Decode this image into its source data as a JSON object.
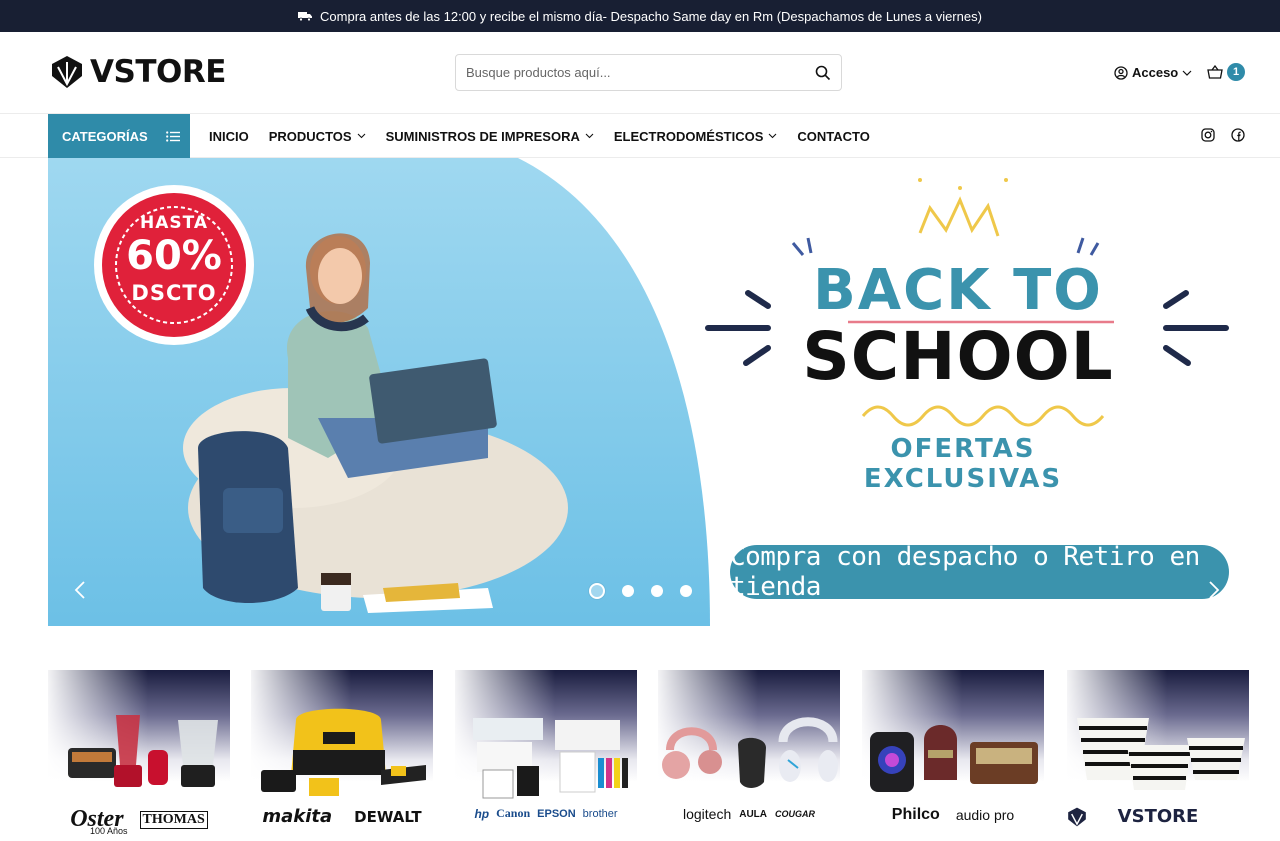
{
  "topbar": {
    "message": "Compra antes de las 12:00 y recibe el mismo día- Despacho Same day en Rm (Despachamos de Lunes a viernes)",
    "icon": "truck-icon"
  },
  "header": {
    "logo_text": "VSTORE",
    "search_placeholder": "Busque productos aquí...",
    "account_label": "Acceso",
    "cart_count": "1"
  },
  "nav": {
    "categories_label": "CATEGORÍAS",
    "items": [
      {
        "label": "INICIO",
        "dropdown": false
      },
      {
        "label": "PRODUCTOS",
        "dropdown": true
      },
      {
        "label": "SUMINISTROS DE IMPRESORA",
        "dropdown": true
      },
      {
        "label": "ELECTRODOMÉSTICOS",
        "dropdown": true
      },
      {
        "label": "CONTACTO",
        "dropdown": false
      }
    ],
    "social": [
      "instagram-icon",
      "facebook-icon"
    ]
  },
  "hero": {
    "seal_line1": "HASTA",
    "seal_line2": "60%",
    "seal_line3": "DSCTO",
    "title_line1": "BACK TO",
    "title_line2": "SCHOOL",
    "subtitle": "OFERTAS EXCLUSIVAS",
    "cta": "Compra con despacho o Retiro en tienda",
    "slide_count": 4,
    "active_slide": 1,
    "colors": {
      "accent": "#3b93ad",
      "seal_red": "#e0213a",
      "sky": "#8fd0ec"
    }
  },
  "brand_cards": [
    {
      "brands": [
        "Oster",
        "THOMAS"
      ],
      "extra": "100 Años"
    },
    {
      "brands": [
        "makita",
        "DEWALT"
      ]
    },
    {
      "brands": [
        "hp",
        "Canon",
        "EPSON",
        "brother"
      ]
    },
    {
      "brands": [
        "logitech",
        "AULA",
        "COUGAR"
      ]
    },
    {
      "brands": [
        "Philco",
        "audio pro"
      ]
    },
    {
      "brands": [
        "VSTORE"
      ]
    }
  ]
}
